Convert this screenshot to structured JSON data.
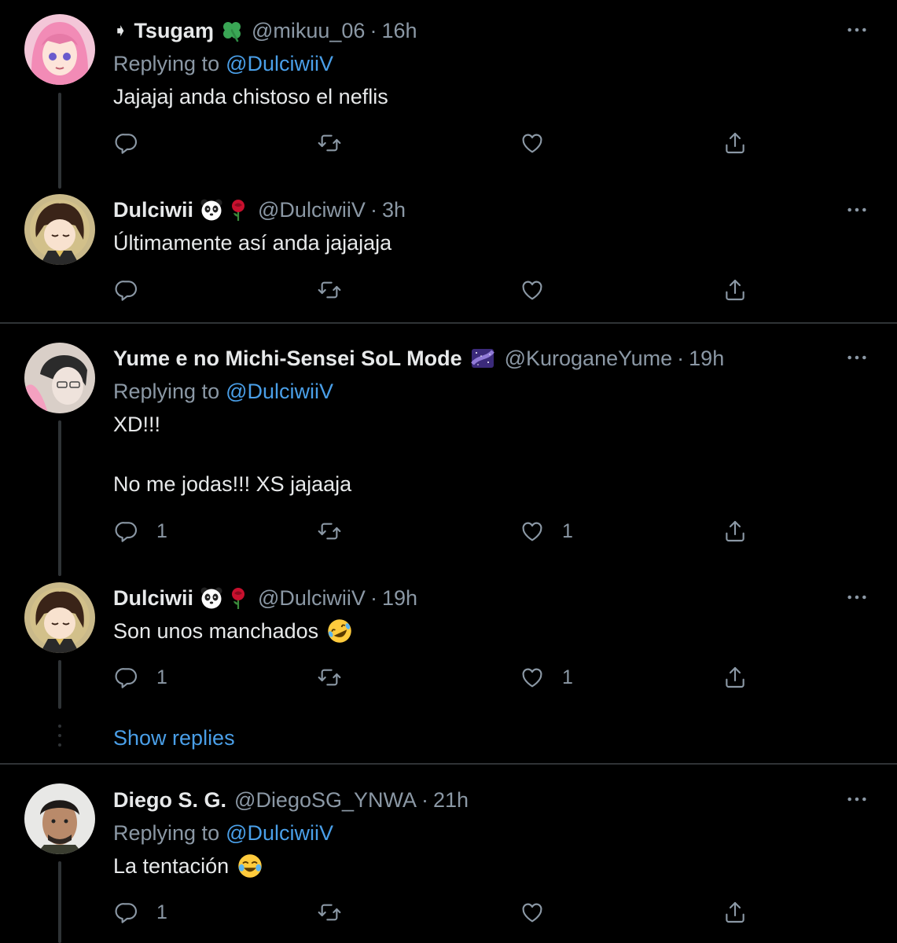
{
  "tweets": [
    {
      "name": "Tsugaɱ",
      "name_prefix": "➧",
      "name_emoji": "four-leaf-clover",
      "handle": "@mikuu_06",
      "time": "16h",
      "replying_label": "Replying to",
      "replying_to": "@DulciwiiV",
      "text": "Jajajaj anda chistoso el neflis",
      "reply_count": "",
      "retweet_count": "",
      "like_count": ""
    },
    {
      "name": "Dulciwii",
      "name_emoji": "panda-rose",
      "handle": "@DulciwiiV",
      "time": "3h",
      "text": "Últimamente así anda jajajaja",
      "reply_count": "",
      "retweet_count": "",
      "like_count": ""
    },
    {
      "name": "Yume e no Michi-Sensei SoL Mode",
      "name_emoji": "milky-way",
      "handle": "@KuroganeYume",
      "time": "19h",
      "replying_label": "Replying to",
      "replying_to": "@DulciwiiV",
      "text_line1": "XD!!!",
      "text_line2": "No me jodas!!! XS jajaaja",
      "reply_count": "1",
      "retweet_count": "",
      "like_count": "1"
    },
    {
      "name": "Dulciwii",
      "name_emoji": "panda-rose",
      "handle": "@DulciwiiV",
      "time": "19h",
      "text": "Son unos manchados",
      "text_emoji": "rolling-on-floor-laughing",
      "reply_count": "1",
      "retweet_count": "",
      "like_count": "1"
    },
    {
      "name": "Diego S. G.",
      "handle": "@DiegoSG_YNWA",
      "time": "21h",
      "replying_label": "Replying to",
      "replying_to": "@DulciwiiV",
      "text": "La tentación",
      "text_emoji": "face-with-tears-of-joy",
      "reply_count": "1",
      "retweet_count": "",
      "like_count": ""
    }
  ],
  "show_replies_label": "Show replies",
  "colors": {
    "background": "#000000",
    "link": "#4a9fe8",
    "secondary_text": "#8b98a5",
    "divider": "#2f3336"
  }
}
